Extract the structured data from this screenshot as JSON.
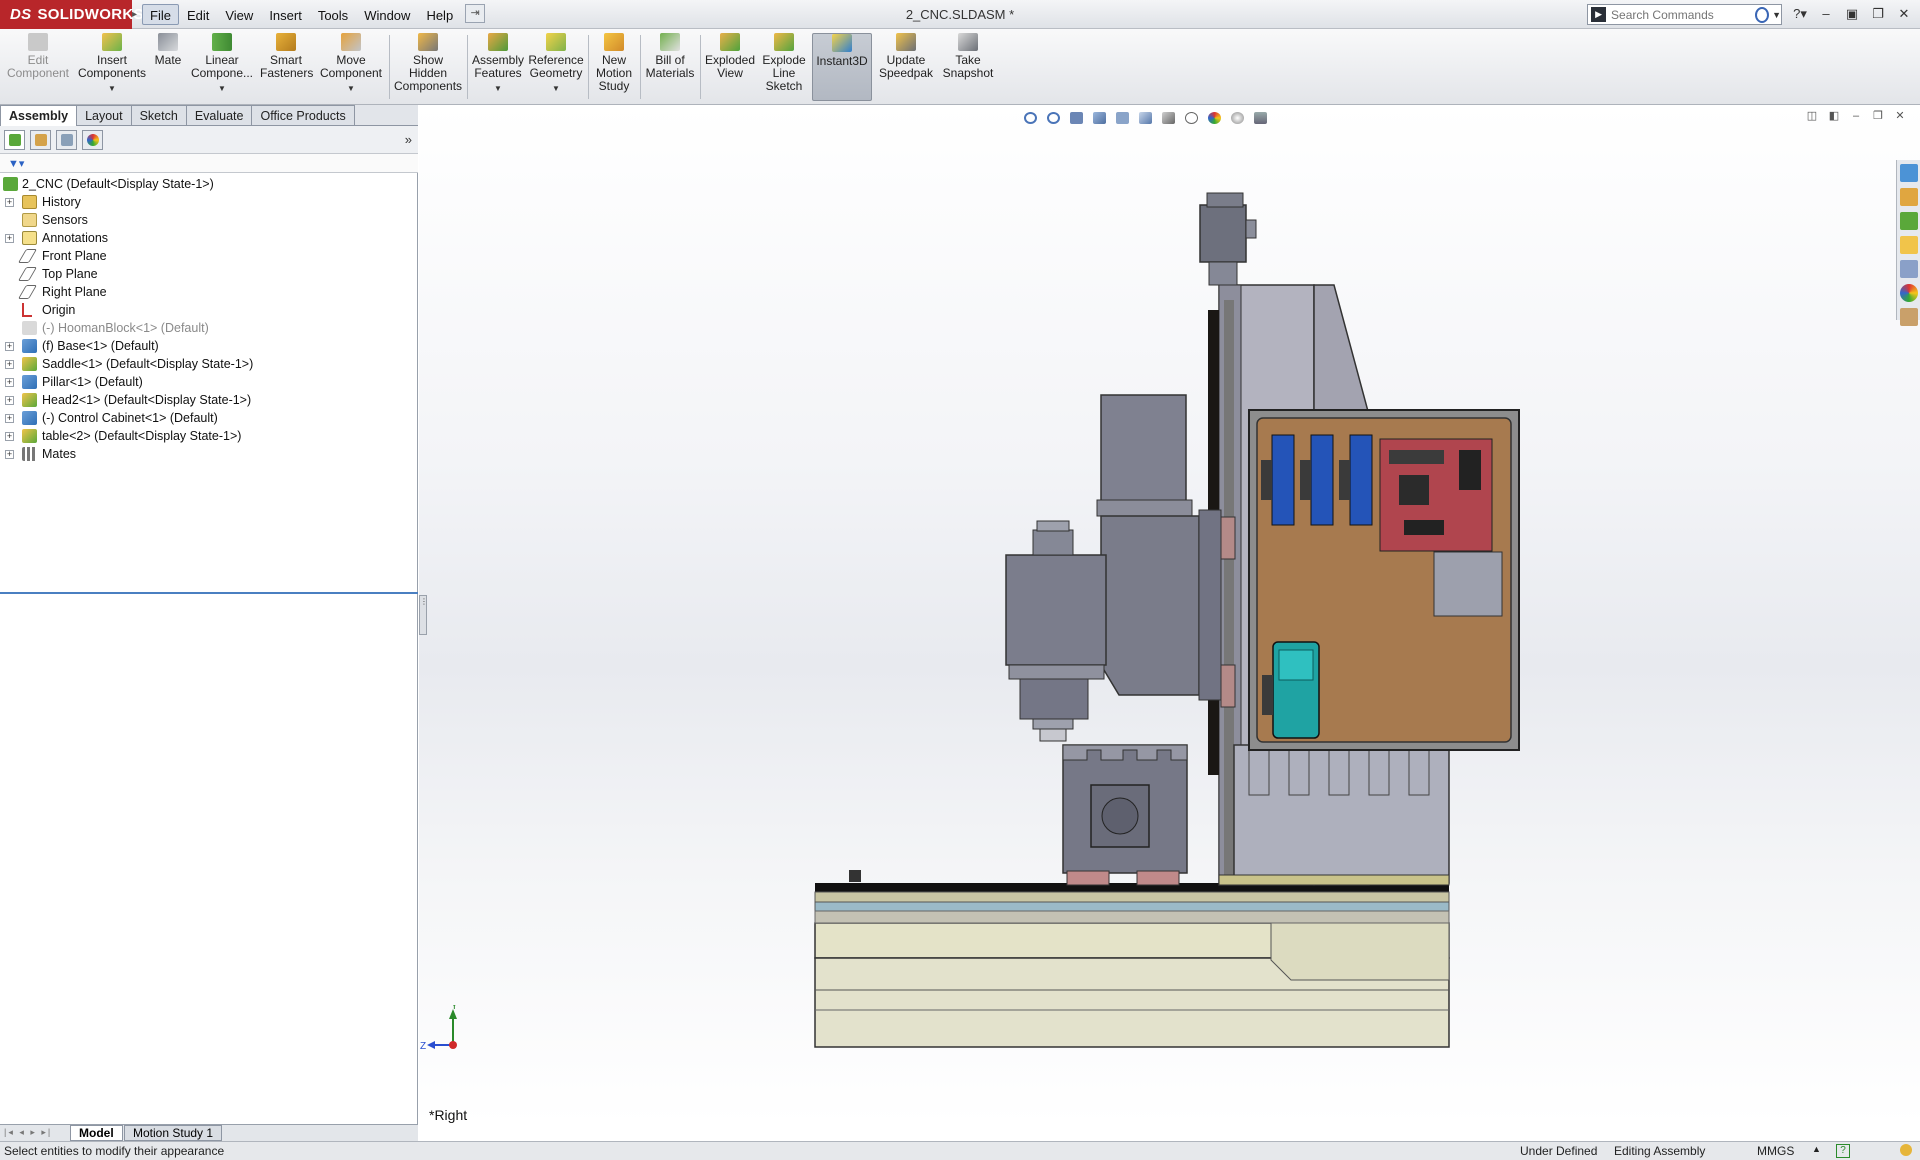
{
  "app": {
    "logo_mark": "DS",
    "logo_text": "SOLIDWORKS",
    "document_title": "2_CNC.SLDASM *"
  },
  "menu": [
    "File",
    "Edit",
    "View",
    "Insert",
    "Tools",
    "Window",
    "Help"
  ],
  "search": {
    "placeholder": "Search Commands"
  },
  "toolbar": {
    "edit_component": "Edit Component",
    "insert_components": "Insert Components",
    "mate": "Mate",
    "linear_component": "Linear Compone...",
    "smart_fasteners": "Smart Fasteners",
    "move_component": "Move Component",
    "show_hidden": "Show Hidden Components",
    "assembly_features": "Assembly Features",
    "reference_geometry": "Reference Geometry",
    "new_motion_study": "New Motion Study",
    "bill_of_materials": "Bill of Materials",
    "exploded_view": "Exploded View",
    "explode_line_sketch": "Explode Line Sketch",
    "instant3d": "Instant3D",
    "update_speedpak": "Update Speedpak",
    "take_snapshot": "Take Snapshot"
  },
  "tabs": [
    "Assembly",
    "Layout",
    "Sketch",
    "Evaluate",
    "Office Products"
  ],
  "tree": {
    "root": "2_CNC  (Default<Display State-1>)",
    "items": [
      "History",
      "Sensors",
      "Annotations",
      "Front Plane",
      "Top Plane",
      "Right Plane",
      "Origin",
      "(-) HoomanBlock<1> (Default)",
      "(f) Base<1> (Default)",
      "Saddle<1> (Default<Display State-1>)",
      "Pillar<1> (Default)",
      "Head2<1> (Default<Display State-1>)",
      "(-) Control Cabinet<1> (Default)",
      "table<2> (Default<Display State-1>)",
      "Mates"
    ]
  },
  "bottom_tabs": [
    "Model",
    "Motion Study 1"
  ],
  "status": {
    "message": "Select entities to modify their appearance",
    "definition": "Under Defined",
    "mode": "Editing Assembly",
    "units": "MMGS"
  },
  "viewport": {
    "view_name": "*Right",
    "triad_y": "Y",
    "triad_z": "Z"
  },
  "colors": {
    "brand": "#b8262a",
    "cabinet_panel": "#a77a4f",
    "driver_blue": "#2454b8",
    "board_red": "#b0454e",
    "psu_teal": "#1fa3a3",
    "machine_gray": "#7a7f8c",
    "base_cream": "#e3e2cc",
    "rail_blue": "#9bbac7"
  },
  "icons": [
    "search-icon",
    "help-icon",
    "minimize-icon",
    "maximize-icon",
    "close-icon"
  ]
}
